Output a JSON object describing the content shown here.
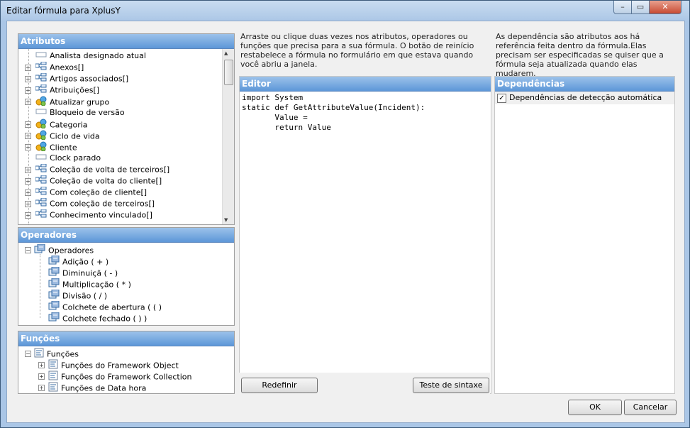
{
  "window": {
    "title": "Editar fórmula para XplusY",
    "min_glyph": "–",
    "max_glyph": "▭",
    "close_glyph": "✕"
  },
  "attributes": {
    "header": "Atributos",
    "items": [
      {
        "label": "Analista designado atual",
        "icon": "field-icon",
        "expandable": false
      },
      {
        "label": "Anexos[]",
        "icon": "collection-icon",
        "expandable": true
      },
      {
        "label": "Artigos associados[]",
        "icon": "collection-icon",
        "expandable": true
      },
      {
        "label": "Atribuições[]",
        "icon": "collection-icon",
        "expandable": true
      },
      {
        "label": "Atualizar grupo",
        "icon": "group-icon",
        "expandable": true
      },
      {
        "label": "Bloqueio de versão",
        "icon": "field-icon",
        "expandable": false
      },
      {
        "label": "Categoria",
        "icon": "group-icon",
        "expandable": true
      },
      {
        "label": "Ciclo de vida",
        "icon": "group-icon",
        "expandable": true
      },
      {
        "label": "Cliente",
        "icon": "group-icon",
        "expandable": true
      },
      {
        "label": "Clock parado",
        "icon": "field-icon",
        "expandable": false
      },
      {
        "label": "Coleção de volta de terceiros[]",
        "icon": "collection-icon",
        "expandable": true
      },
      {
        "label": "Coleção de volta do cliente[]",
        "icon": "collection-icon",
        "expandable": true
      },
      {
        "label": "Com coleção de cliente[]",
        "icon": "collection-icon",
        "expandable": true
      },
      {
        "label": "Com coleção de terceiros[]",
        "icon": "collection-icon",
        "expandable": true
      },
      {
        "label": "Conhecimento vinculado[]",
        "icon": "collection-icon",
        "expandable": true
      }
    ]
  },
  "operators": {
    "header": "Operadores",
    "root": "Operadores",
    "items": [
      "Adição ( + )",
      "Diminuiçã ( - )",
      "Multiplicação ( * )",
      "Divisão ( / )",
      "Colchete de abertura ( ( )",
      "Colchete fechado ( ) )"
    ]
  },
  "functions": {
    "header": "Funções",
    "root": "Funções",
    "items": [
      "Funções do Framework Object",
      "Funções do Framework Collection",
      "Funções de Data hora"
    ]
  },
  "editor": {
    "instructions": "Arraste ou clique duas vezes nos atributos, operadores ou funções que precisa para a sua fórmula. O botão de reinício restabelece a fórmula no formulário em que estava quando você abriu a janela.",
    "header": "Editor",
    "code": "import System\nstatic def GetAttributeValue(Incident):\n       Value =\n       return Value",
    "reset_label": "Redefinir",
    "syntax_label": "Teste de sintaxe"
  },
  "dependencies": {
    "instructions": "As dependência são atributos aos há referência feita dentro da fórmula.Elas precisam ser especificadas se quiser que a fórmula seja atualizada quando elas mudarem.",
    "header": "Dependências",
    "auto_detect_label": "Dependências de detecção automática",
    "auto_detect_checked": true,
    "check_glyph": "✓"
  },
  "footer": {
    "ok_label": "OK",
    "cancel_label": "Cancelar"
  }
}
